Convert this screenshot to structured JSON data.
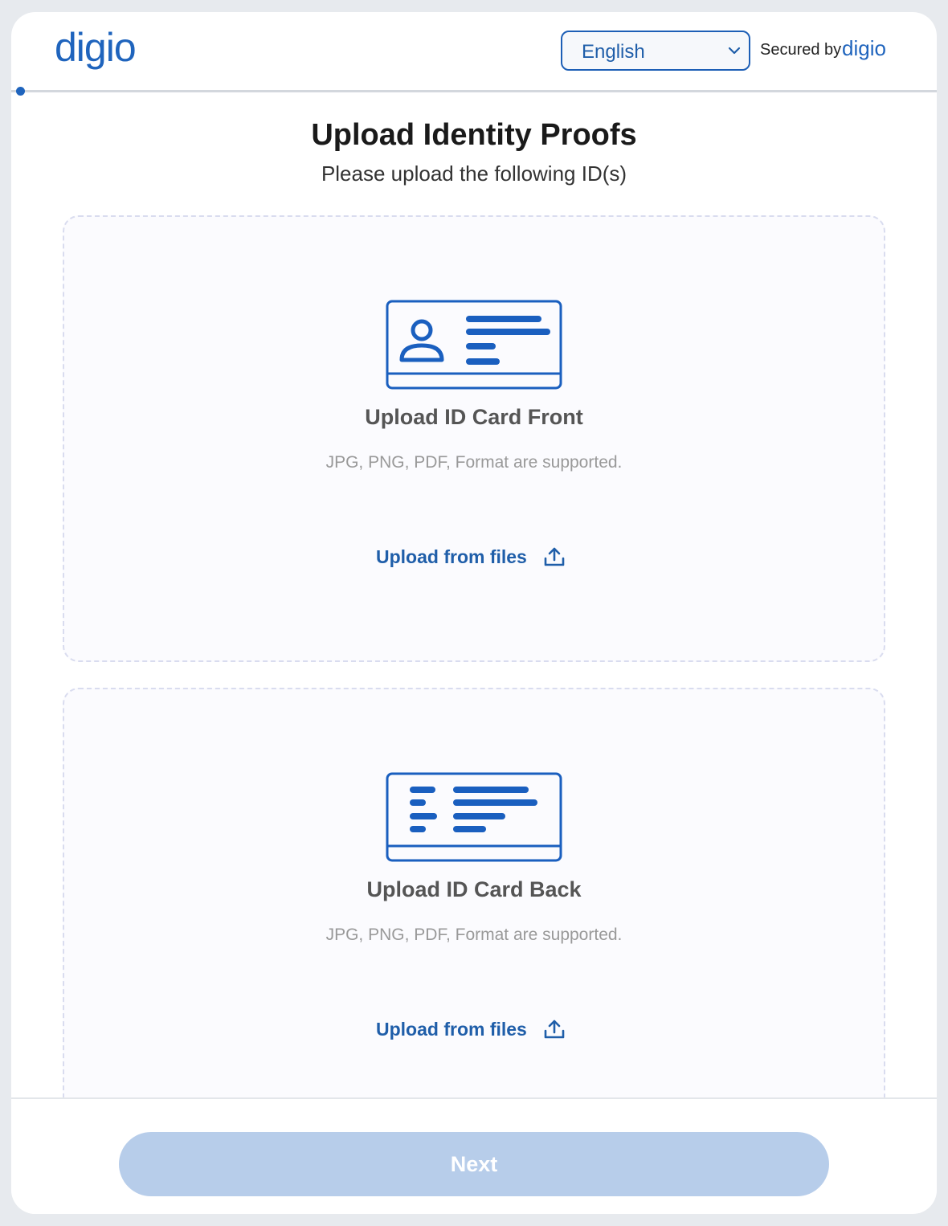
{
  "header": {
    "brand": "digio",
    "language": {
      "selected": "English"
    },
    "secured_by_label": "Secured by",
    "secured_by_brand": "digio"
  },
  "progress": {
    "fraction": 0.0
  },
  "page": {
    "title": "Upload Identity Proofs",
    "subtitle": "Please upload the following ID(s)"
  },
  "uploads": [
    {
      "title": "Upload ID Card Front",
      "hint": "JPG, PNG, PDF, Format are supported.",
      "link_label": "Upload from files",
      "icon": "id-card-front-icon"
    },
    {
      "title": "Upload ID Card Back",
      "hint": "JPG, PNG, PDF, Format are supported.",
      "link_label": "Upload from files",
      "icon": "id-card-back-icon"
    }
  ],
  "footer": {
    "next_label": "Next"
  },
  "colors": {
    "brand_blue": "#1f64bd",
    "button_disabled": "#b7cdea",
    "page_bg": "#e7eaee"
  }
}
